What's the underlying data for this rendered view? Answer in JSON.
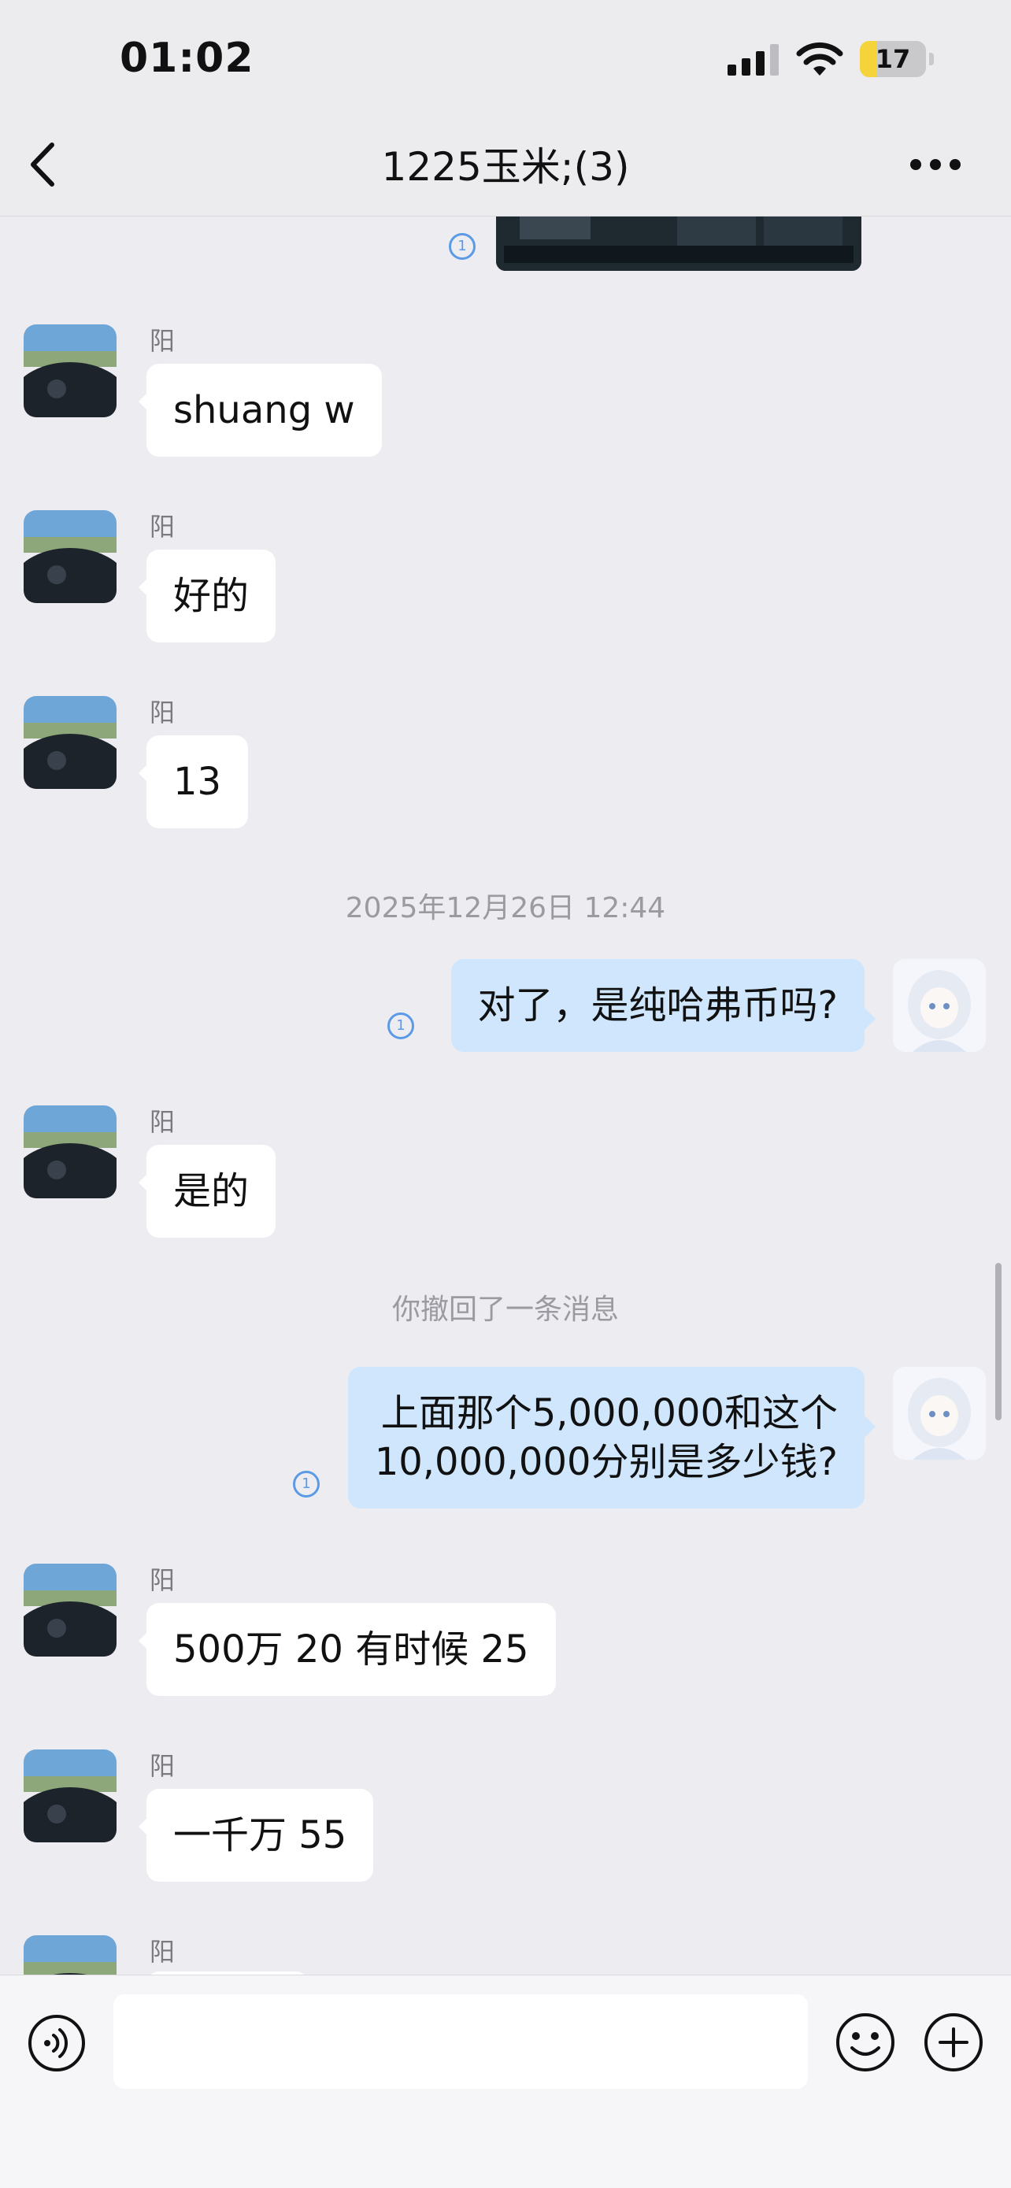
{
  "status_bar": {
    "time": "01:02",
    "battery": "17",
    "battery_level": 0.17
  },
  "header": {
    "title": "1225玉米;(3)"
  },
  "read_marker": "1",
  "messages": [
    {
      "sender": "阳",
      "text": "shuang w"
    },
    {
      "sender": "阳",
      "text": "好的"
    },
    {
      "sender": "阳",
      "text": "13"
    },
    {
      "system": "2025年12月26日 12:44"
    },
    {
      "text": "对了，是纯哈弗币吗?"
    },
    {
      "sender": "阳",
      "text": "是的"
    },
    {
      "system": "你撤回了一条消息"
    },
    {
      "text_line1": "上面那个5,000,000和这个",
      "text_line2": "10,000,000分别是多少钱?"
    },
    {
      "sender": "阳",
      "text": "500万 20 有时候 25"
    },
    {
      "sender": "阳",
      "text": "一千万 55"
    },
    {
      "sender": "阳"
    }
  ],
  "input_bar": {
    "placeholder": ""
  },
  "colors": {
    "outgoing_bubble": "#cfe6fd",
    "incoming_bubble": "#ffffff",
    "background": "#ededf1",
    "read_marker": "#5b9ae6"
  }
}
